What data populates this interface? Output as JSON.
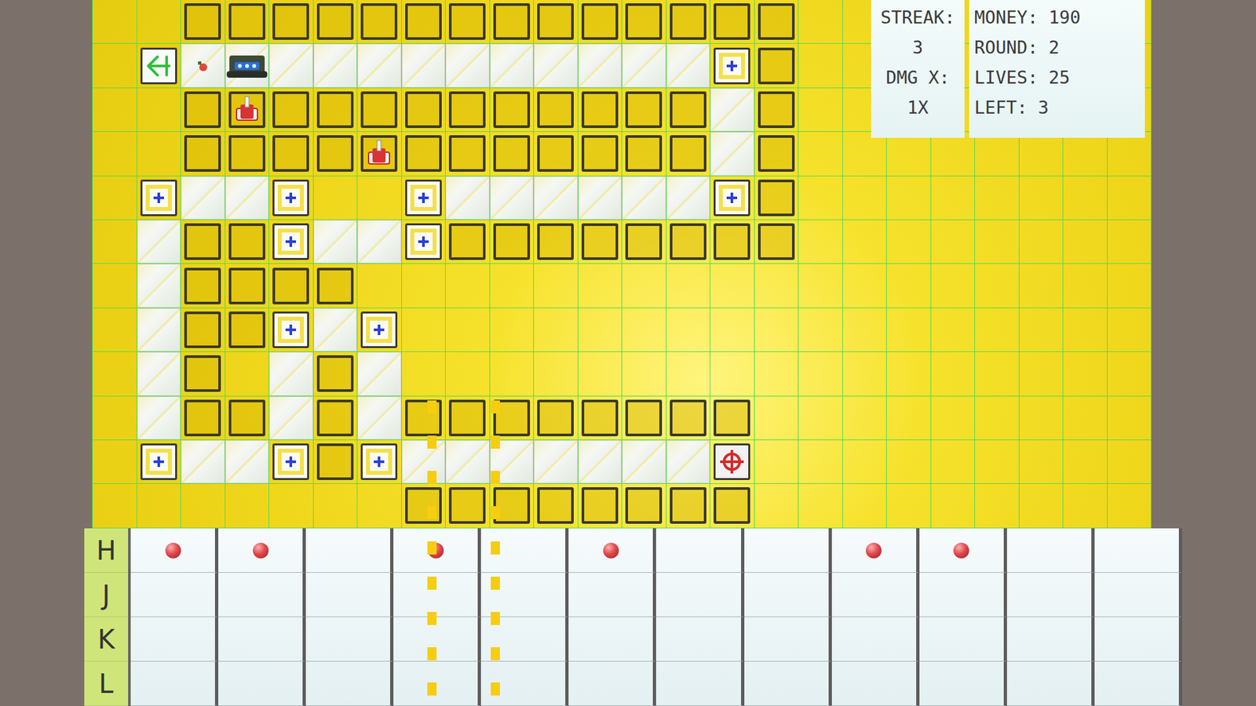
{
  "hud": {
    "streak": {
      "label": "STREAK:",
      "value": "3"
    },
    "multiplier": {
      "label": "DMG X:",
      "value": "1X"
    },
    "stats": [
      {
        "label": "MONEY:",
        "value": "190"
      },
      {
        "label": "ROUND:",
        "value": "2"
      },
      {
        "label": "LIVES:",
        "value": "25"
      },
      {
        "label": "LEFT:",
        "value": "3"
      }
    ]
  },
  "board": {
    "rows": [
      "..WWWWWWWWWWWWWW........",
      ".SeEPPPPPPPPPPNW........",
      "..WTWWWWWWWWWWPW........",
      "..WWWWTWWWWWWWPW........",
      ".NPPN..NPPPPPPNW........",
      ".PWWNPPNWWWWWWWW........",
      ".PWWWW..................",
      ".PWWNPN.................",
      ".PW.PWP.................",
      ".PWWPWPWWWWWWWW.........",
      ".NPPNWNPPPPPPPX.........",
      ".......WWWWWWWW........."
    ]
  },
  "selection": {
    "from_col": 7,
    "to_col": 8
  },
  "sequencer": {
    "lanes": [
      {
        "label": "H",
        "steps": [
          true,
          true,
          false,
          true,
          false,
          true,
          false,
          false,
          true,
          true,
          false,
          false
        ]
      },
      {
        "label": "J",
        "steps": [
          false,
          false,
          false,
          false,
          false,
          false,
          false,
          false,
          false,
          false,
          false,
          false
        ]
      },
      {
        "label": "K",
        "steps": [
          false,
          false,
          false,
          false,
          false,
          false,
          false,
          false,
          false,
          false,
          false,
          false
        ]
      },
      {
        "label": "L",
        "steps": [
          false,
          false,
          false,
          false,
          false,
          false,
          false,
          false,
          false,
          false,
          false,
          false
        ]
      }
    ]
  }
}
